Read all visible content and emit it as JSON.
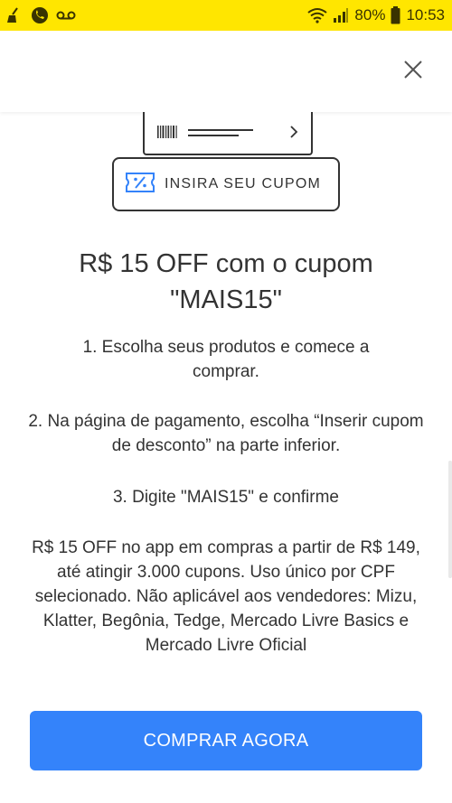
{
  "status_bar": {
    "battery_percent": "80%",
    "time": "10:53",
    "icons": [
      "broom-icon",
      "phone-icon",
      "voicemail-icon",
      "wifi-icon",
      "signal-icon",
      "battery-icon"
    ],
    "background_color": "#ffe600"
  },
  "header": {
    "close_icon": "close-icon"
  },
  "illustration": {
    "coupon_label": "INSIRA SEU CUPOM",
    "icons": [
      "barcode-icon",
      "chevron-right-icon",
      "coupon-ticket-icon"
    ]
  },
  "content": {
    "title": "R$ 15 OFF com o cupom \"MAIS15\"",
    "steps": [
      "1. Escolha seus produtos e comece a comprar.",
      "2. Na página de pagamento, escolha “Inserir cupom de desconto” na parte inferior.",
      "3. Digite \"MAIS15\" e confirme"
    ],
    "terms": "R$ 15 OFF no app em compras a partir de R$ 149, até atingir 3.000 cupons. Uso único por CPF selecionado. Não aplicável aos vendedores: Mizu, Klatter, Begônia, Tedge, Mercado Livre Basics e Mercado Livre Oficial"
  },
  "actions": {
    "buy_now_label": "COMPRAR AGORA",
    "button_color": "#3483fa"
  }
}
